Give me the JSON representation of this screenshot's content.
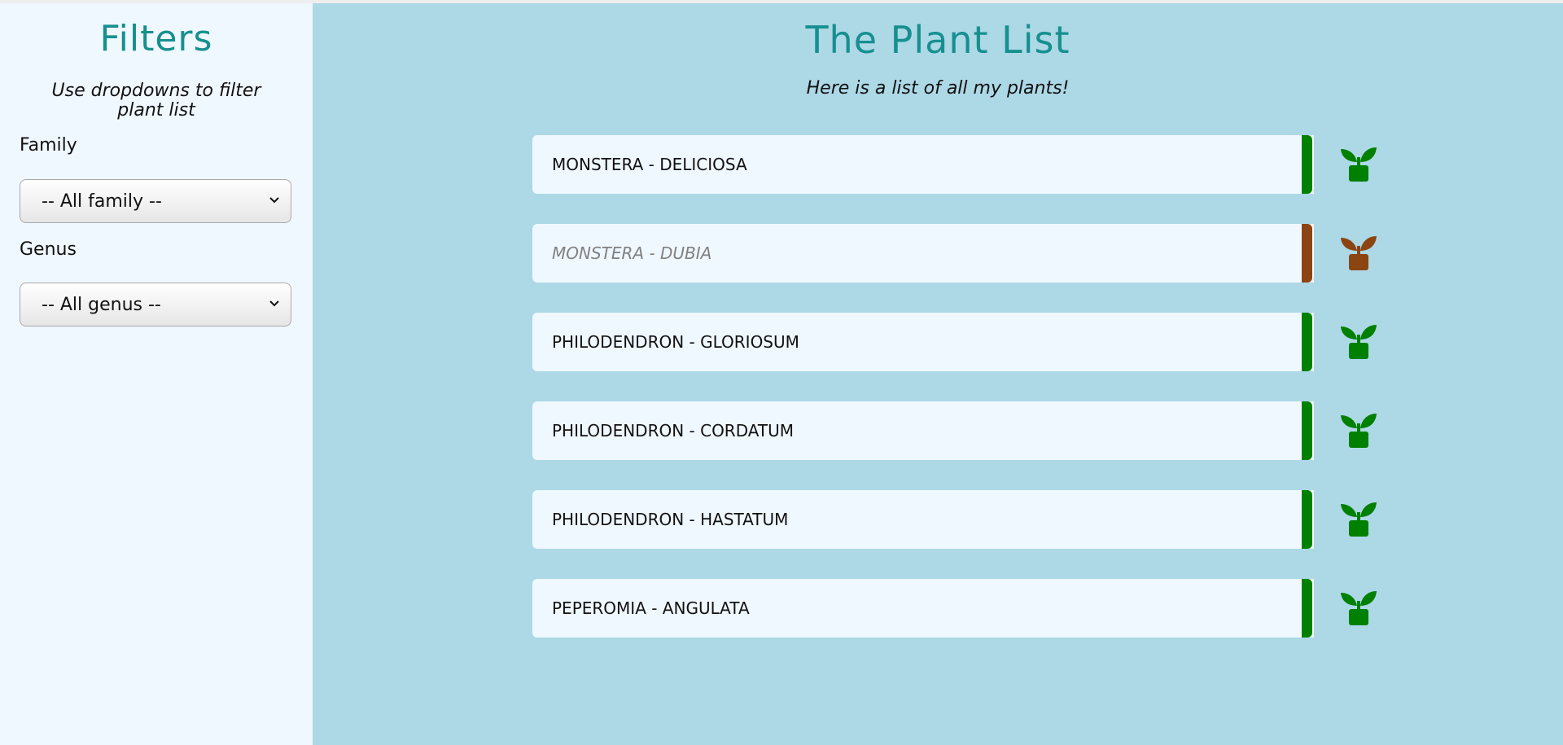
{
  "sidebar": {
    "title": "Filters",
    "subtitle": "Use dropdowns to filter plant list",
    "family_label": "Family",
    "family_selected": "-- All family --",
    "genus_label": "Genus",
    "genus_selected": "-- All genus --"
  },
  "main": {
    "title": "The Plant List",
    "subtitle": "Here is a list of all my plants!"
  },
  "colors": {
    "alive": "#008000",
    "dead": "#8b4513",
    "heading": "#16908f",
    "sidebar_bg": "#f0f8ff",
    "main_bg": "#add8e6"
  },
  "plants": [
    {
      "name": "MONSTERA - DELICIOSA",
      "status": "alive",
      "icon": "plant-icon"
    },
    {
      "name": "MONSTERA - DUBIA",
      "status": "dead",
      "icon": "plant-icon"
    },
    {
      "name": "PHILODENDRON - GLORIOSUM",
      "status": "alive",
      "icon": "plant-icon"
    },
    {
      "name": "PHILODENDRON - CORDATUM",
      "status": "alive",
      "icon": "plant-icon"
    },
    {
      "name": "PHILODENDRON - HASTATUM",
      "status": "alive",
      "icon": "plant-icon"
    },
    {
      "name": "PEPEROMIA - ANGULATA",
      "status": "alive",
      "icon": "plant-icon"
    }
  ]
}
